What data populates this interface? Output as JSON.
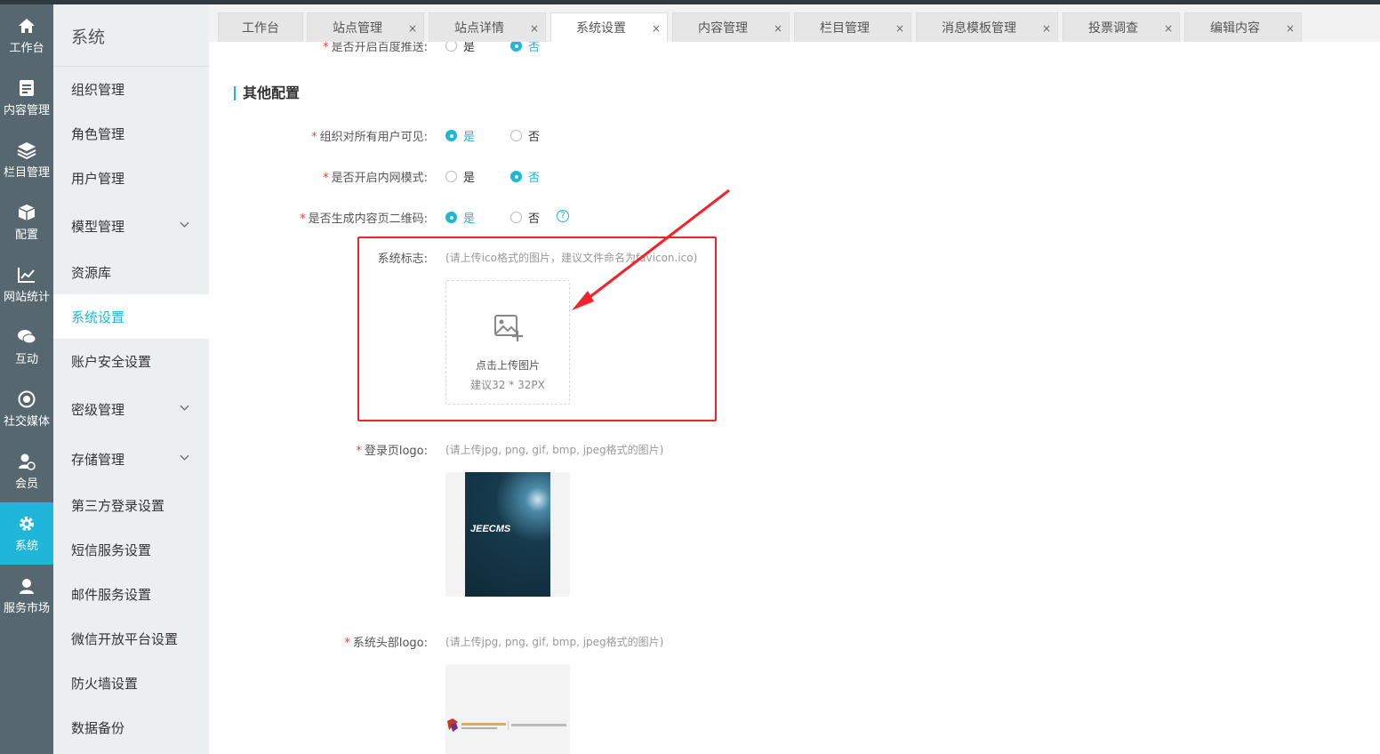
{
  "rail": [
    {
      "label": "工作台",
      "icon": "home-icon"
    },
    {
      "label": "内容管理",
      "icon": "document-icon"
    },
    {
      "label": "栏目管理",
      "icon": "layers-icon"
    },
    {
      "label": "配置",
      "icon": "box-icon"
    },
    {
      "label": "网站统计",
      "icon": "chart-icon"
    },
    {
      "label": "互动",
      "icon": "chat-icon"
    },
    {
      "label": "社交媒体",
      "icon": "target-icon"
    },
    {
      "label": "会员",
      "icon": "member-icon"
    },
    {
      "label": "系统",
      "icon": "gear-icon",
      "active": true
    },
    {
      "label": "服务市场",
      "icon": "service-icon"
    }
  ],
  "side": {
    "title": "系统",
    "items": [
      {
        "label": "组织管理"
      },
      {
        "label": "角色管理"
      },
      {
        "label": "用户管理"
      },
      {
        "label": "模型管理",
        "expandable": true
      },
      {
        "label": "资源库"
      },
      {
        "label": "系统设置",
        "active": true
      },
      {
        "label": "账户安全设置"
      },
      {
        "label": "密级管理",
        "expandable": true
      },
      {
        "label": "存储管理",
        "expandable": true
      },
      {
        "label": "第三方登录设置"
      },
      {
        "label": "短信服务设置"
      },
      {
        "label": "邮件服务设置"
      },
      {
        "label": "微信开放平台设置"
      },
      {
        "label": "防火墙设置"
      },
      {
        "label": "数据备份"
      }
    ]
  },
  "tabs": [
    {
      "label": "工作台",
      "closable": false
    },
    {
      "label": "站点管理",
      "closable": true
    },
    {
      "label": "站点详情",
      "closable": true
    },
    {
      "label": "系统设置",
      "closable": true,
      "active": true
    },
    {
      "label": "内容管理",
      "closable": true
    },
    {
      "label": "栏目管理",
      "closable": true
    },
    {
      "label": "消息模板管理",
      "closable": true
    },
    {
      "label": "投票调查",
      "closable": true
    },
    {
      "label": "编辑内容",
      "closable": true
    }
  ],
  "close_glyph": "×",
  "form": {
    "partial_label": "是否开启百度推送:",
    "partial_yes": "是",
    "partial_no": "否",
    "section_title": "其他配置",
    "org_visible_label": "组织对所有用户可见:",
    "intranet_label": "是否开启内网模式:",
    "qrcode_label": "是否生成内容页二维码:",
    "yes": "是",
    "no": "否",
    "help_glyph": "?",
    "logo_label": "系统标志:",
    "logo_hint": "(请上传ico格式的图片，建议文件命名为favicon.ico)",
    "upload_text": "点击上传图片",
    "upload_size": "建议32 * 32PX",
    "login_logo_label": "登录页logo:",
    "login_logo_hint": "(请上传jpg, png, gif, bmp, jpeg格式的图片)",
    "login_logo_brand": "JEECMS",
    "header_logo_label": "系统头部logo:",
    "header_logo_hint": "(请上传jpg, png, gif, bmp, jpeg格式的图片)"
  },
  "colors": {
    "accent": "#1fb6d9",
    "annotation": "#f0242a",
    "rail": "#56676f"
  }
}
